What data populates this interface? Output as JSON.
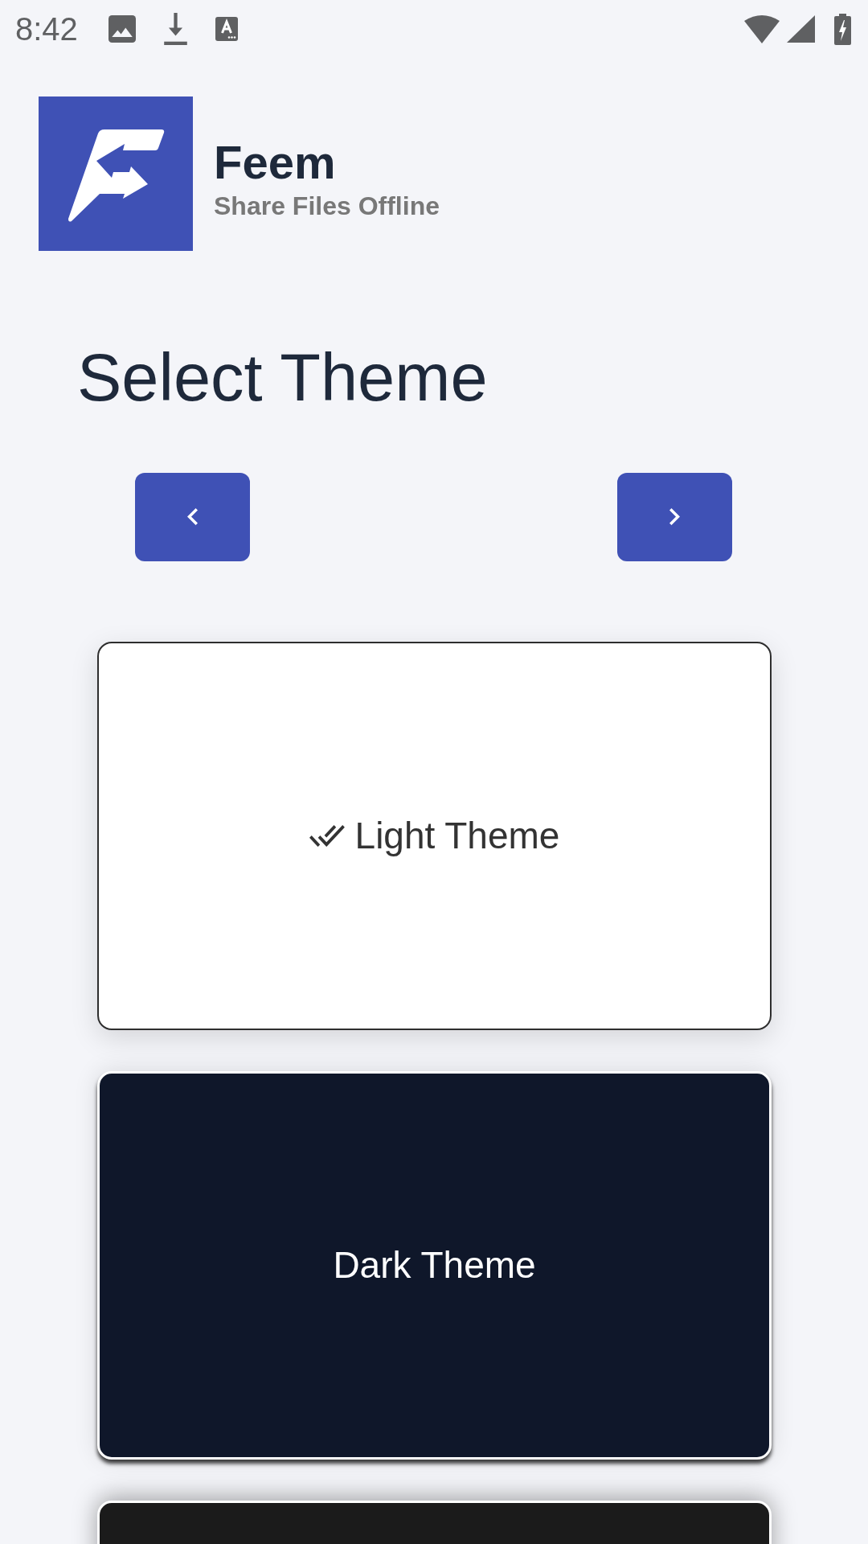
{
  "status_bar": {
    "time": "8:42"
  },
  "app": {
    "name": "Feem",
    "tagline": "Share Files Offline"
  },
  "title": "Select Theme",
  "theme_cards": [
    {
      "kind": "light",
      "label": "Light Theme",
      "selected": true
    },
    {
      "kind": "dark",
      "label": "Dark Theme",
      "selected": false
    },
    {
      "kind": "black"
    }
  ]
}
